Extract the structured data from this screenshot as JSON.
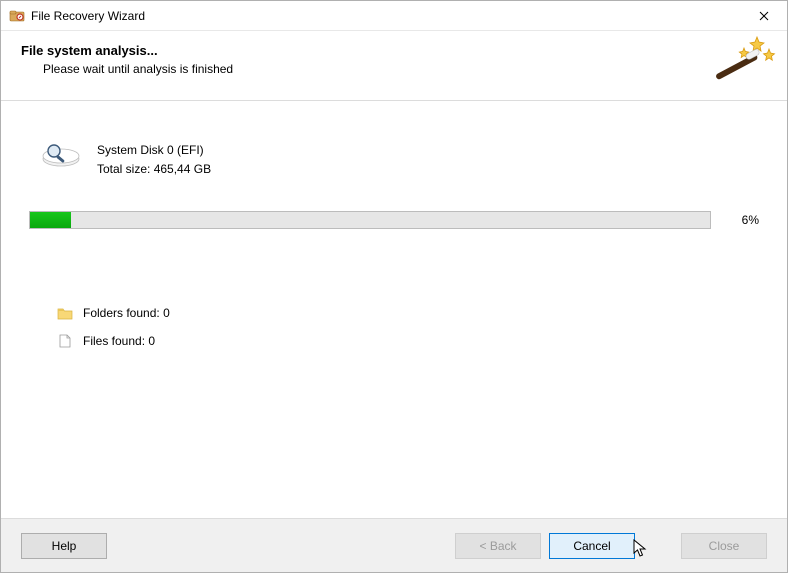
{
  "window": {
    "title": "File Recovery Wizard"
  },
  "banner": {
    "title": "File system analysis...",
    "subtitle": "Please wait until analysis is finished"
  },
  "disk": {
    "name": "System Disk 0 (EFI)",
    "size_label": "Total size:",
    "size_value": "465,44 GB"
  },
  "progress": {
    "percent_value": 6,
    "percent_text": "6%"
  },
  "found": {
    "folders_label": "Folders found:",
    "folders_count": "0",
    "files_label": "Files found:",
    "files_count": "0"
  },
  "footer": {
    "help": "Help",
    "back": "< Back",
    "cancel": "Cancel",
    "close": "Close"
  }
}
